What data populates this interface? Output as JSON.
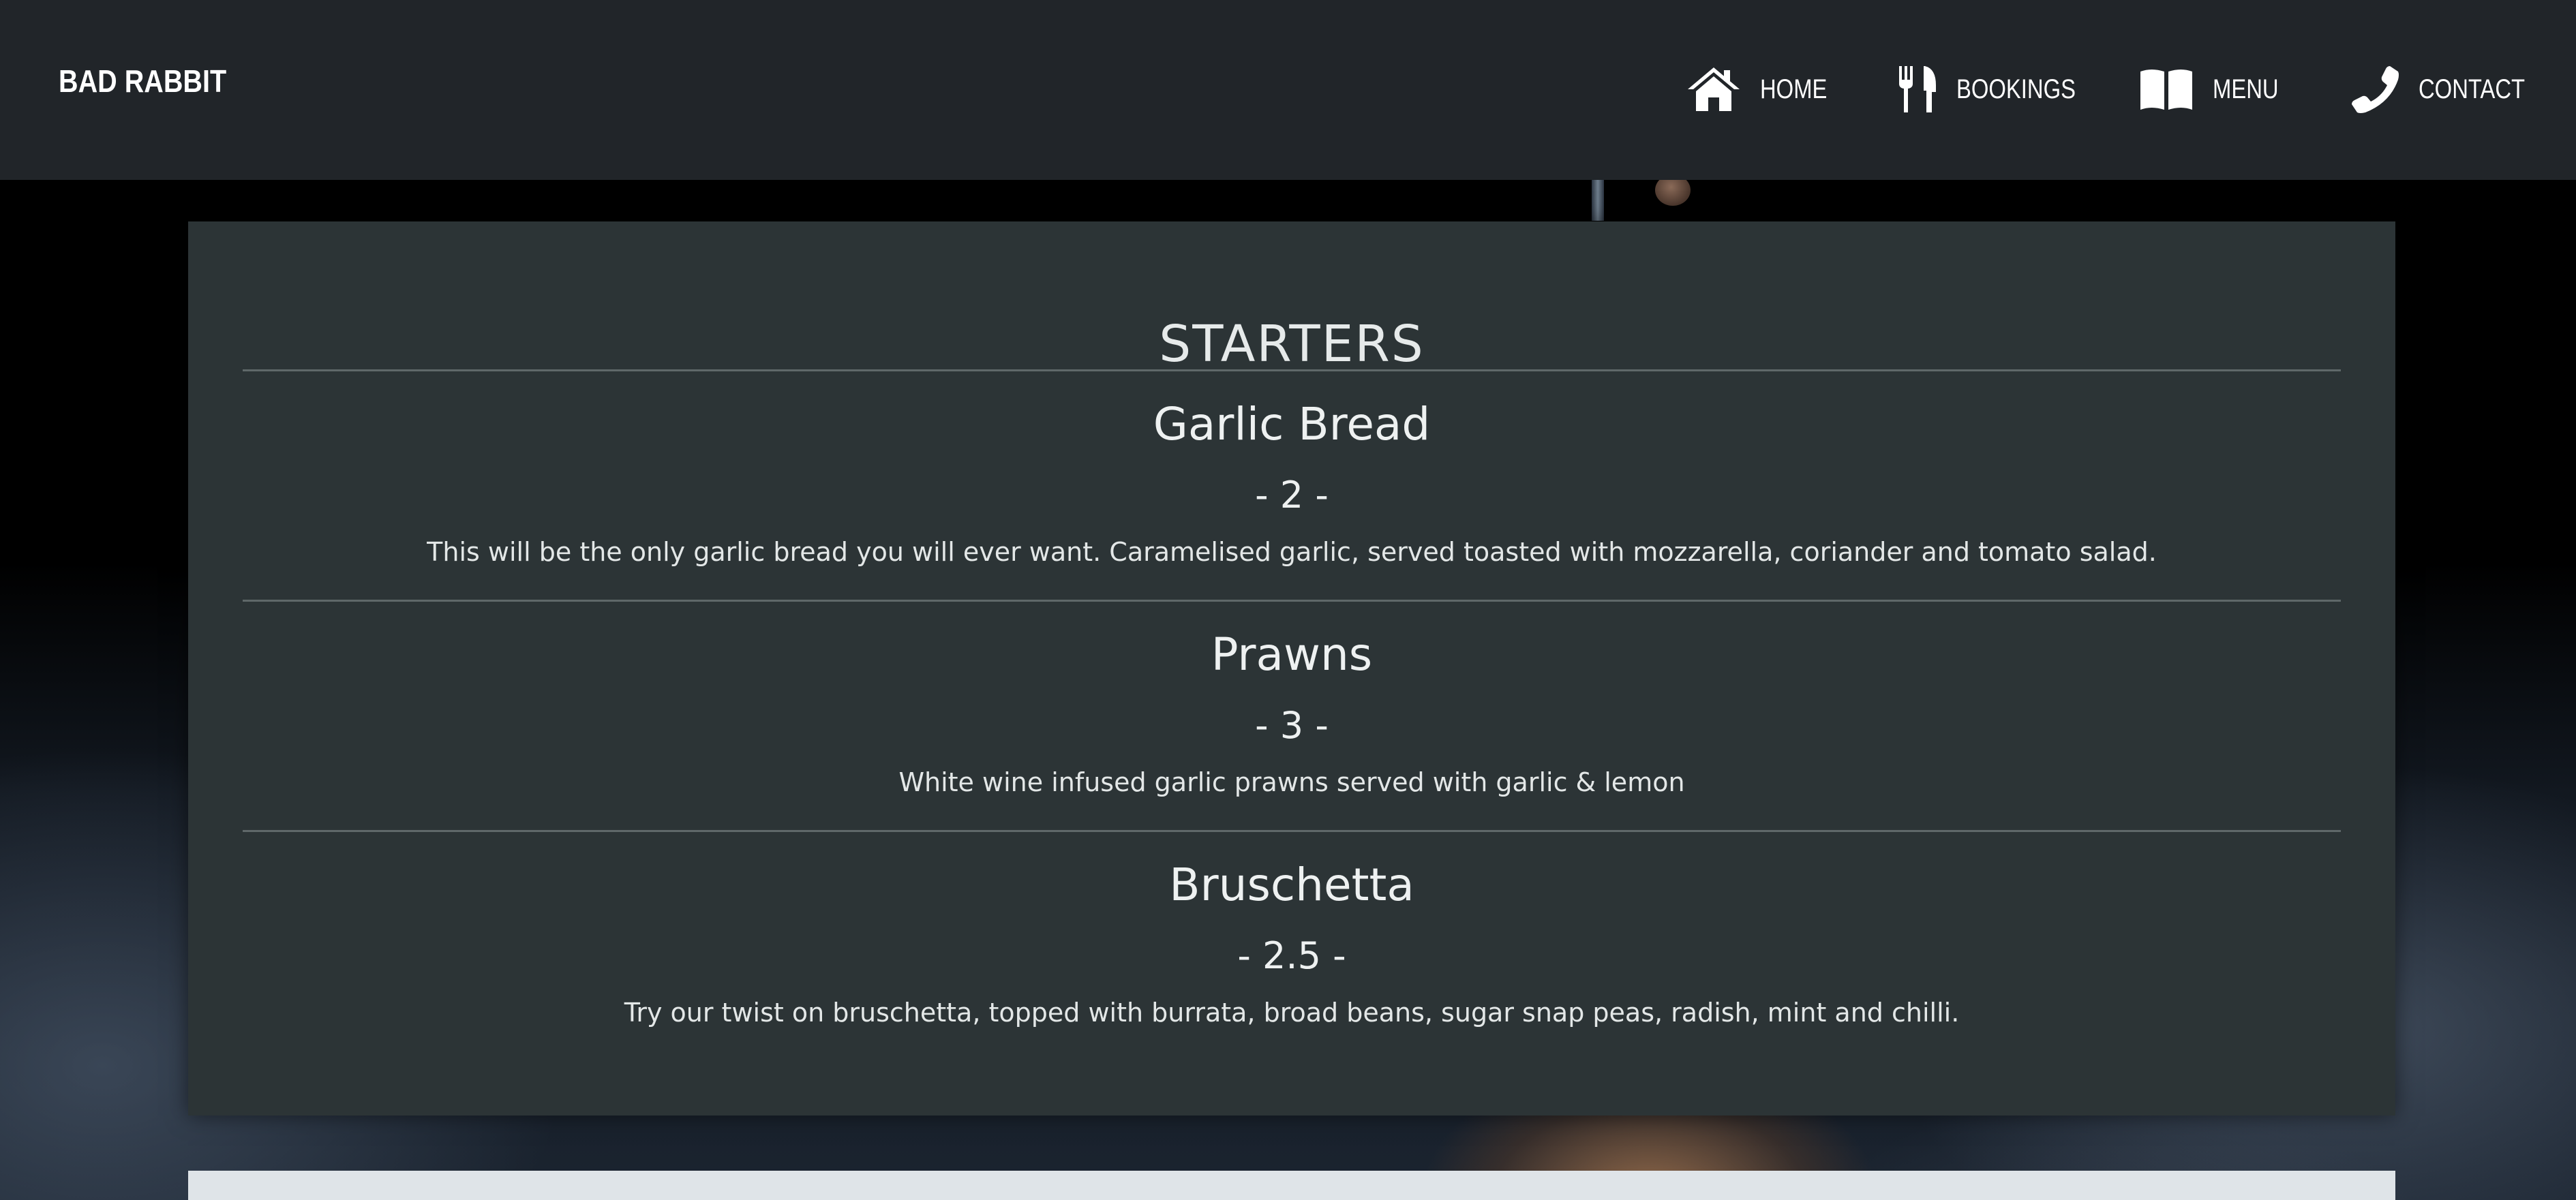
{
  "brand": "BAD RABBIT",
  "nav": {
    "home": {
      "label": "HOME",
      "icon": "home-icon"
    },
    "bookings": {
      "label": "BOOKINGS",
      "icon": "utensils-icon"
    },
    "menu": {
      "label": "MENU",
      "icon": "book-icon"
    },
    "contact": {
      "label": "CONTACT",
      "icon": "phone-icon"
    }
  },
  "menu_section": {
    "title": "STARTERS",
    "items": [
      {
        "name": "Garlic Bread",
        "price": "- 2 -",
        "description": "This will be the only garlic bread you will ever want. Caramelised garlic, served toasted with mozzarella, coriander and tomato salad."
      },
      {
        "name": "Prawns",
        "price": "- 3 -",
        "description": "White wine infused garlic prawns served with garlic & lemon"
      },
      {
        "name": "Bruschetta",
        "price": "- 2.5 -",
        "description": "Try our twist on bruschetta, topped with burrata, broad beans, sugar snap peas, radish, mint and chilli."
      }
    ]
  },
  "colors": {
    "navbar": "#212529",
    "card": "#2c3436",
    "text": "#e6eaea",
    "divider": "#5f6869",
    "next_section": "#dfe4e8"
  }
}
